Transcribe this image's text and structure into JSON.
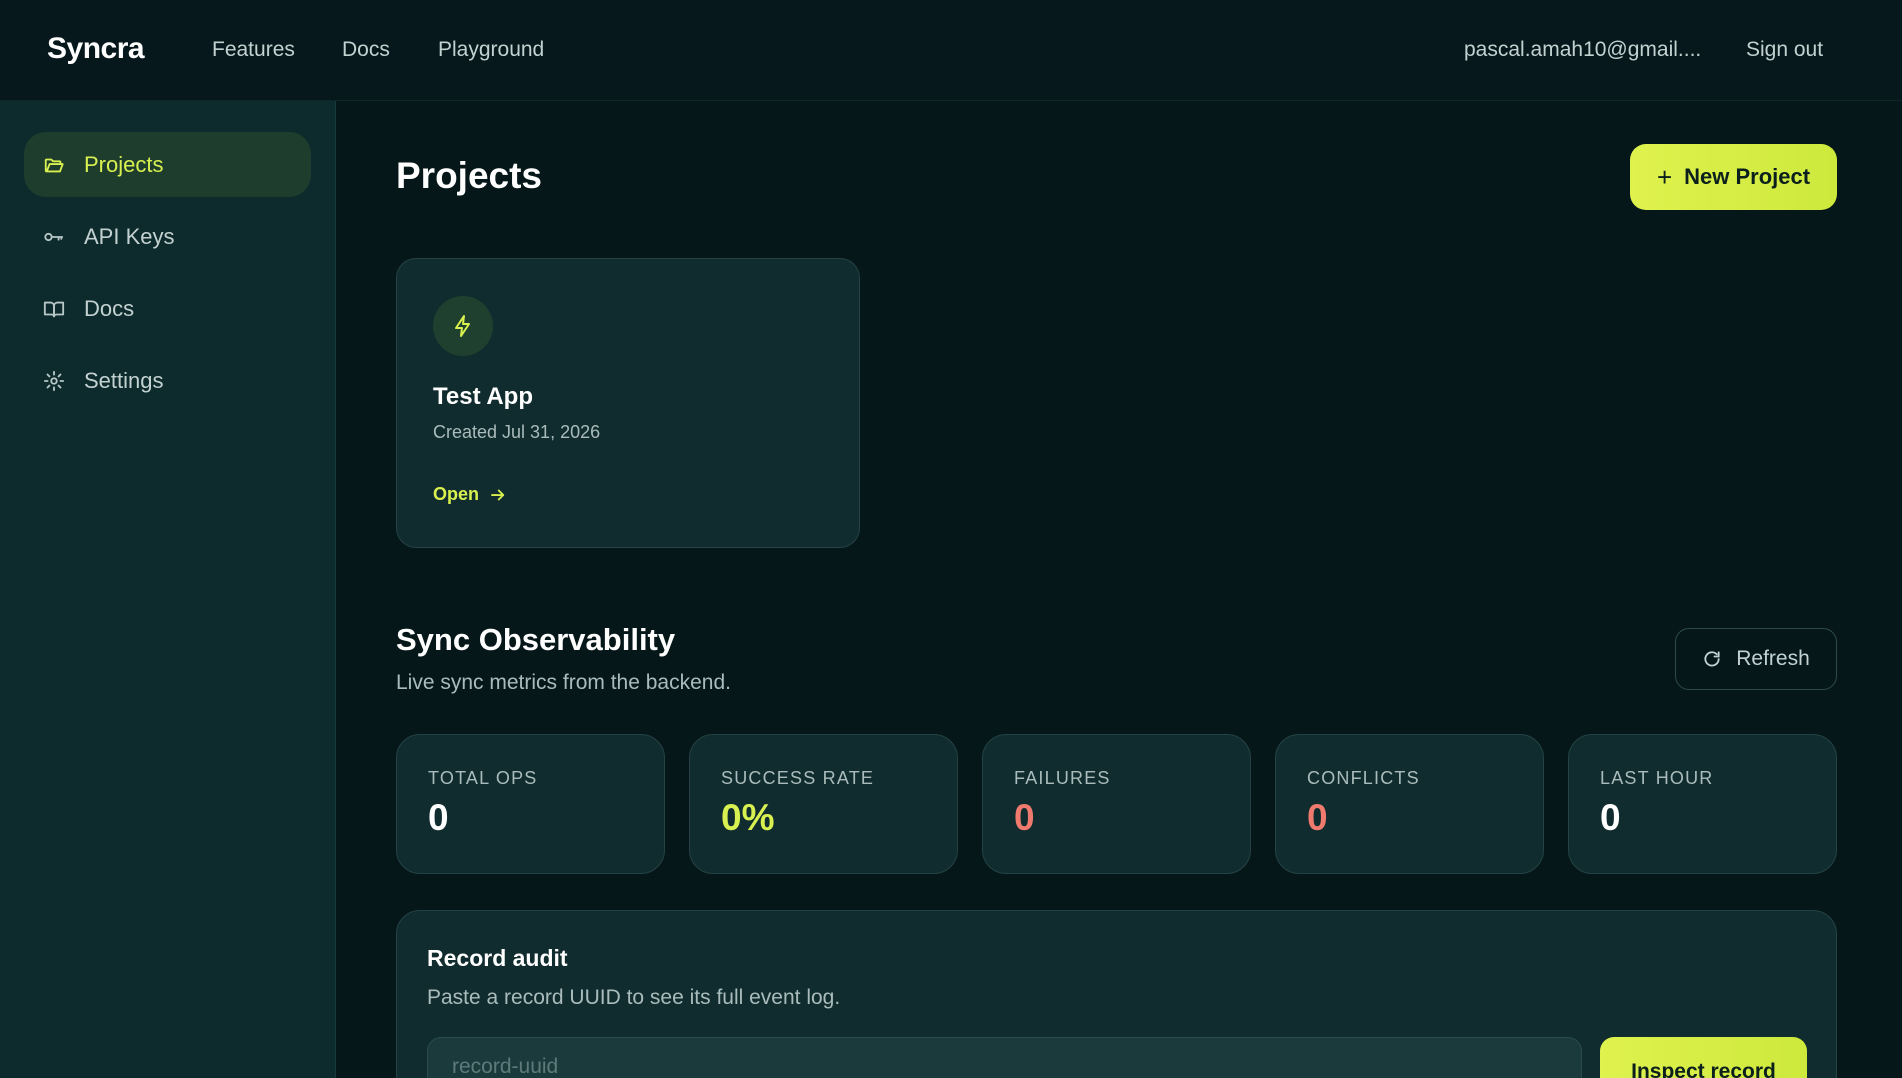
{
  "nav": {
    "brand": "Syncra",
    "links": [
      "Features",
      "Docs",
      "Playground"
    ],
    "user_email": "pascal.amah10@gmail....",
    "signout": "Sign out"
  },
  "sidebar": {
    "items": [
      {
        "label": "Projects",
        "icon": "folder-icon",
        "active": true
      },
      {
        "label": "API Keys",
        "icon": "key-icon",
        "active": false
      },
      {
        "label": "Docs",
        "icon": "book-icon",
        "active": false
      },
      {
        "label": "Settings",
        "icon": "gear-icon",
        "active": false
      }
    ]
  },
  "main": {
    "title": "Projects",
    "new_project_label": "New Project",
    "projects": [
      {
        "name": "Test App",
        "created": "Created Jul 31, 2026",
        "open_label": "Open",
        "icon": "bolt-icon"
      }
    ]
  },
  "observability": {
    "title": "Sync Observability",
    "subtitle": "Live sync metrics from the backend.",
    "refresh_label": "Refresh",
    "stats": [
      {
        "label": "TOTAL OPS",
        "value": "0",
        "color": "#ffffff"
      },
      {
        "label": "SUCCESS RATE",
        "value": "0%",
        "color": "#d8f050"
      },
      {
        "label": "FAILURES",
        "value": "0",
        "color": "#f07a6e"
      },
      {
        "label": "CONFLICTS",
        "value": "0",
        "color": "#f07a6e"
      },
      {
        "label": "LAST HOUR",
        "value": "0",
        "color": "#ffffff"
      }
    ]
  },
  "audit": {
    "title": "Record audit",
    "subtitle": "Paste a record UUID to see its full event log.",
    "placeholder": "record-uuid",
    "button_label": "Inspect record"
  },
  "colors": {
    "accent": "#d8f050",
    "background": "#061719",
    "sidebar": "#0d2a2c",
    "card": "#112c2f",
    "danger": "#f07a6e"
  }
}
